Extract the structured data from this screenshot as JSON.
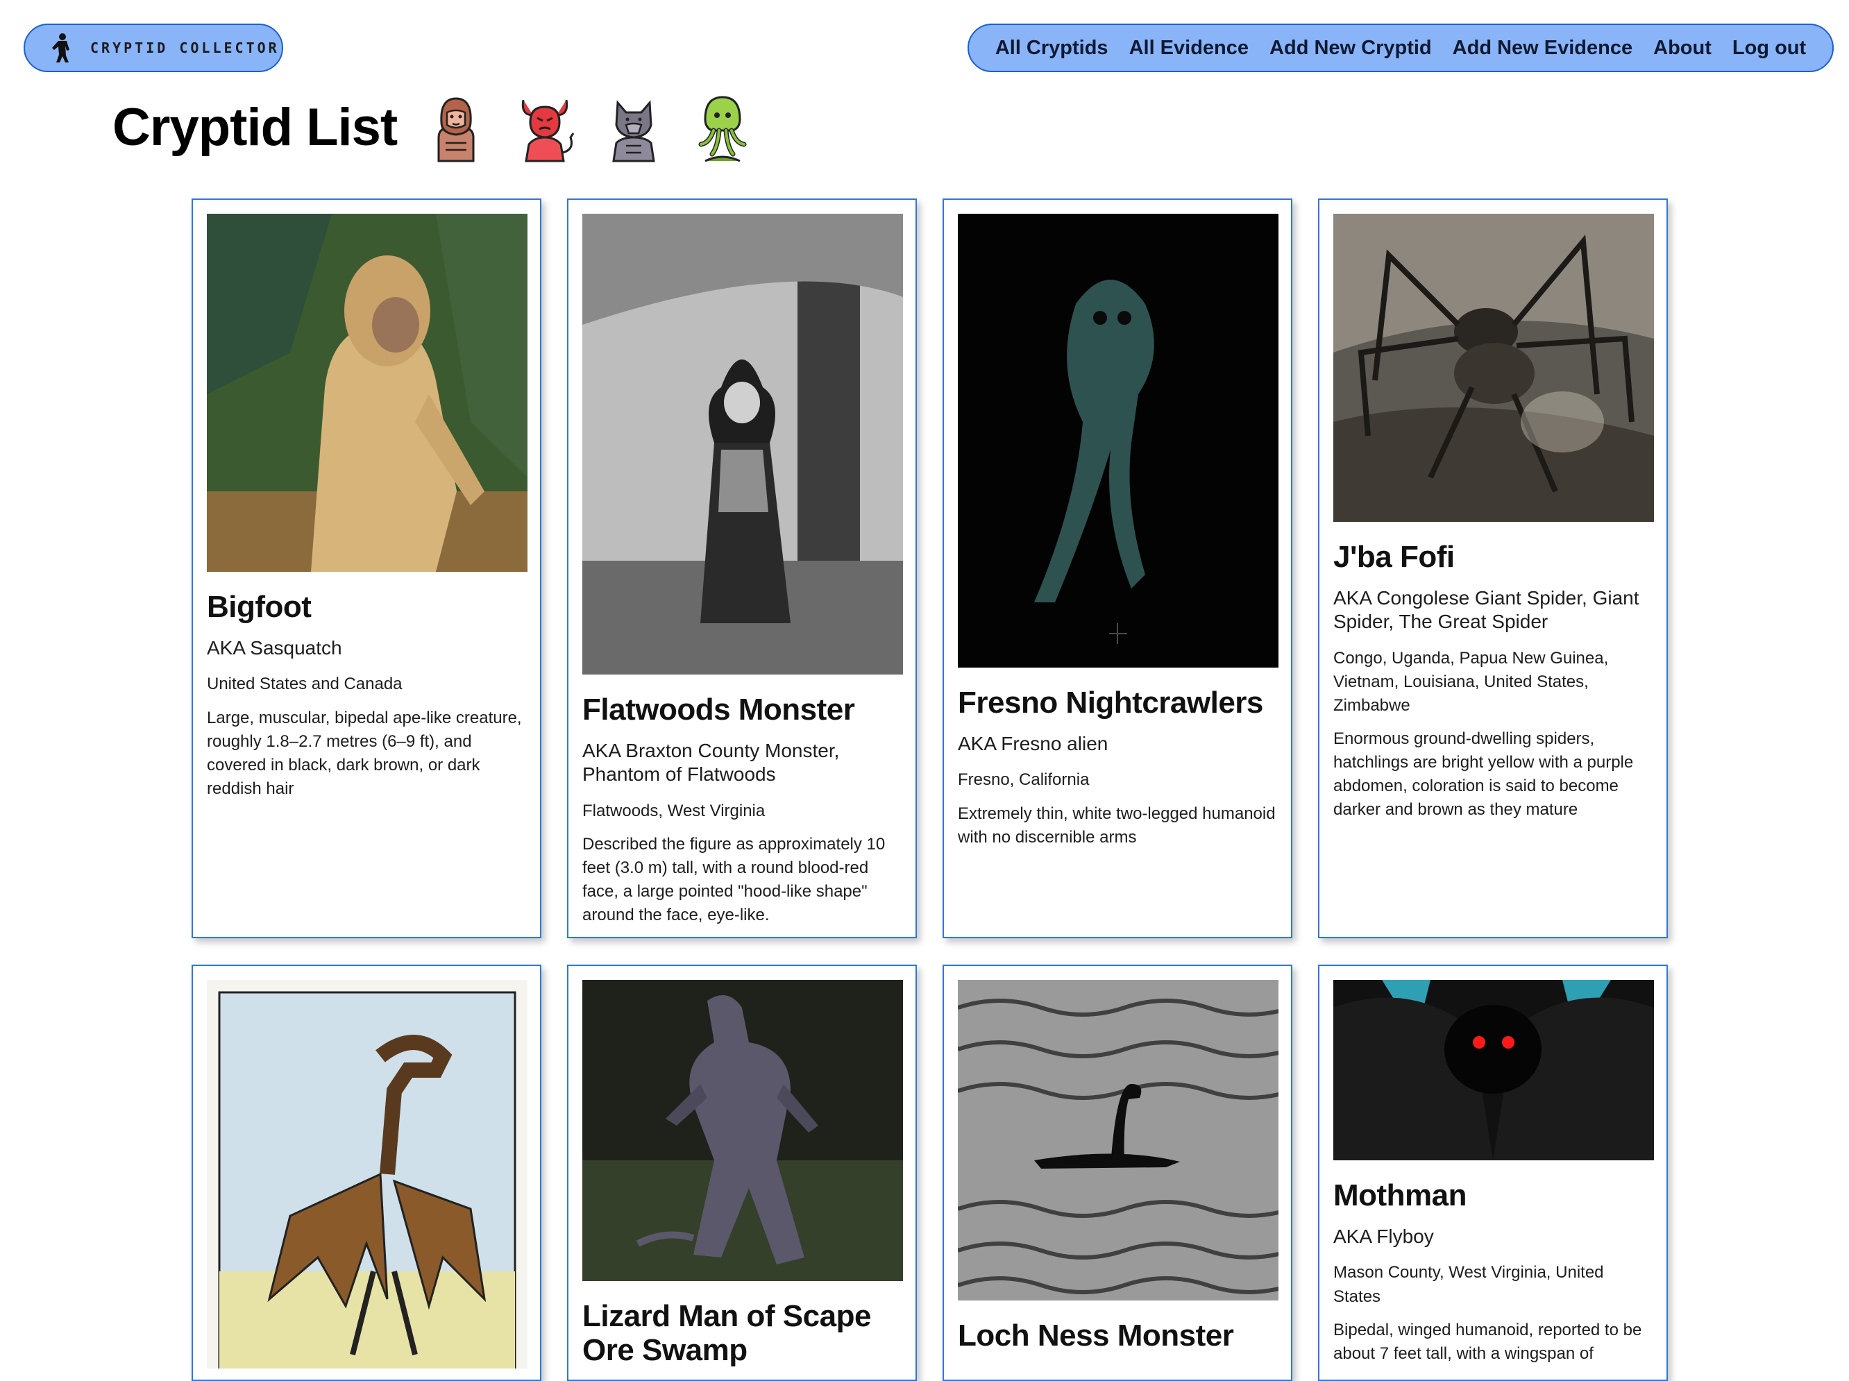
{
  "brand": {
    "name": "CRYPTID COLLECTOR",
    "accent": "#8ab4f8",
    "border": "#1a5fd6"
  },
  "nav": {
    "all_cryptids": "All Cryptids",
    "all_evidence": "All Evidence",
    "add_cryptid": "Add New Cryptid",
    "add_evidence": "Add New Evidence",
    "about": "About",
    "logout": "Log out"
  },
  "page": {
    "title": "Cryptid List"
  },
  "title_icons": [
    "bigfoot-icon",
    "devil-icon",
    "werewolf-icon",
    "cthulhu-icon"
  ],
  "cryptids": [
    {
      "name": "Bigfoot",
      "aka": "AKA Sasquatch",
      "location": "United States and Canada",
      "description": "Large, muscular, bipedal ape-like creature, roughly 1.8–2.7 metres (6–9 ft), and covered in black, dark brown, or dark reddish hair"
    },
    {
      "name": "Flatwoods Monster",
      "aka": "AKA Braxton County Monster, Phantom of Flatwoods",
      "location": "Flatwoods, West Virginia",
      "description": "Described the figure as approximately 10 feet (3.0 m) tall, with a round blood-red face, a large pointed \"hood-like shape\" around the face, eye-like."
    },
    {
      "name": "Fresno Nightcrawlers",
      "aka": "AKA Fresno alien",
      "location": "Fresno, California",
      "description": "Extremely thin, white two-legged humanoid with no discernible arms"
    },
    {
      "name": "J'ba Fofi",
      "aka": "AKA Congolese Giant Spider, Giant Spider, The Great Spider",
      "location": "Congo, Uganda, Papua New Guinea, Vietnam, Louisiana, United States, Zimbabwe",
      "description": "Enormous ground-dwelling spiders, hatchlings are bright yellow with a purple abdomen, coloration is said to become darker and brown as they mature"
    },
    {
      "name": "",
      "aka": "",
      "location": "",
      "description": ""
    },
    {
      "name": "Lizard Man of Scape Ore Swamp",
      "aka": "",
      "location": "",
      "description": ""
    },
    {
      "name": "Loch Ness Monster",
      "aka": "",
      "location": "",
      "description": ""
    },
    {
      "name": "Mothman",
      "aka": "AKA Flyboy",
      "location": "Mason County, West Virginia, United States",
      "description": "Bipedal, winged humanoid, reported to be about 7 feet tall, with a wingspan of"
    }
  ]
}
